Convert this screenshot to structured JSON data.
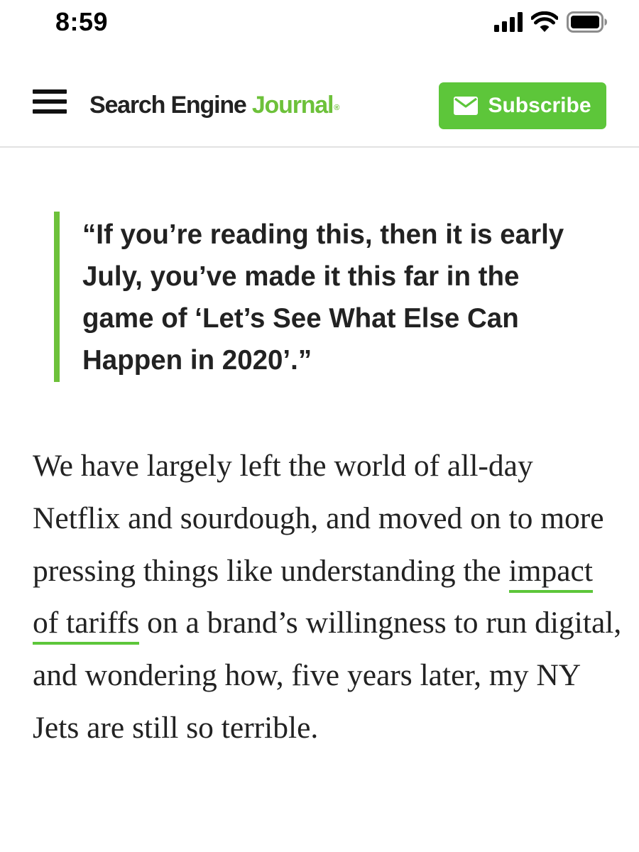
{
  "status_bar": {
    "time": "8:59",
    "icons": [
      "signal-icon",
      "wifi-icon",
      "battery-icon"
    ]
  },
  "header": {
    "logo": {
      "part1": "Search Engine ",
      "part2": "Journal",
      "registered": "®"
    },
    "menu_icon": "hamburger-menu-icon",
    "subscribe": {
      "icon": "envelope-icon",
      "label": "Subscribe"
    }
  },
  "article": {
    "quote": "“If you’re reading this, then it is early July, you’ve made it this far in the game of ‘Let’s See What Else Can Happen in 2020’.”",
    "paragraph": {
      "before_link": "We have largely left the world of all-day Netflix and sourdough, and moved on to more pressing things like understanding the ",
      "link_text": "impact of tariffs",
      "after_link": " on a brand’s willingness to run digital, and wondering how, five years later, my NY Jets are still so terrible."
    }
  },
  "colors": {
    "brand_green": "#6dc13a",
    "button_green": "#5dc63a",
    "text": "#222222",
    "divider": "#e2e2e2"
  }
}
